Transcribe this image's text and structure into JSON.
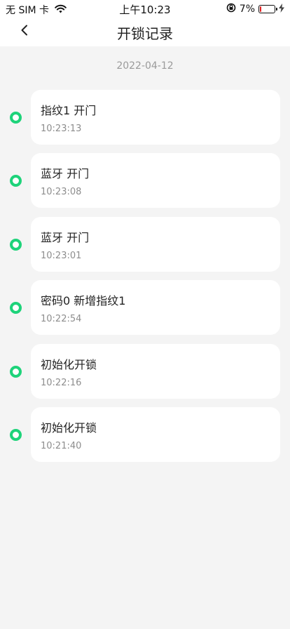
{
  "status_bar": {
    "carrier": "无 SIM 卡",
    "time": "上午10:23",
    "battery_percent": "7%",
    "battery_level": 0.07,
    "icons": [
      "wifi-icon",
      "rotation-lock-icon",
      "battery-icon",
      "charging-bolt-icon"
    ]
  },
  "nav": {
    "title": "开锁记录",
    "back_icon": "chevron-left-icon"
  },
  "date": "2022-04-12",
  "colors": {
    "accent": "#1ed37a",
    "background": "#f4f4f4",
    "card": "#ffffff",
    "battery_low": "#e02020"
  },
  "records": [
    {
      "title": "指纹1 开门",
      "time": "10:23:13"
    },
    {
      "title": "蓝牙 开门",
      "time": "10:23:08"
    },
    {
      "title": "蓝牙 开门",
      "time": "10:23:01"
    },
    {
      "title": "密码0 新增指纹1",
      "time": "10:22:54"
    },
    {
      "title": " 初始化开锁",
      "time": "10:22:16"
    },
    {
      "title": " 初始化开锁",
      "time": "10:21:40"
    }
  ]
}
